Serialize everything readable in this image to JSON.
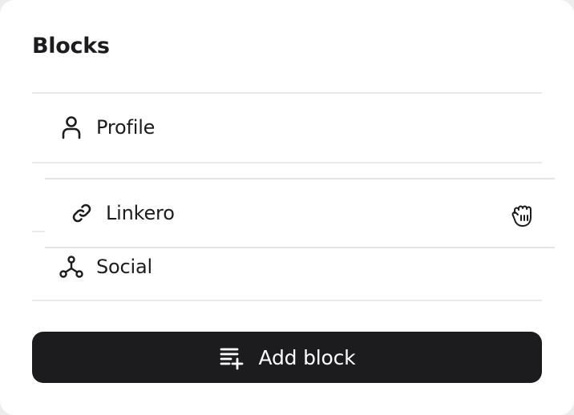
{
  "panel": {
    "title": "Blocks"
  },
  "blocks": [
    {
      "label": "Profile",
      "icon": "user-icon"
    },
    {
      "label": "Linkero",
      "icon": "link-icon",
      "state": "dragging"
    },
    {
      "label": "Social",
      "icon": "social-network-icon"
    }
  ],
  "add_button": {
    "label": "Add block",
    "icon": "list-add-icon"
  },
  "colors": {
    "button_background": "#1c1c1e",
    "text": "#1c1c1e",
    "divider": "#e9e9e9"
  }
}
